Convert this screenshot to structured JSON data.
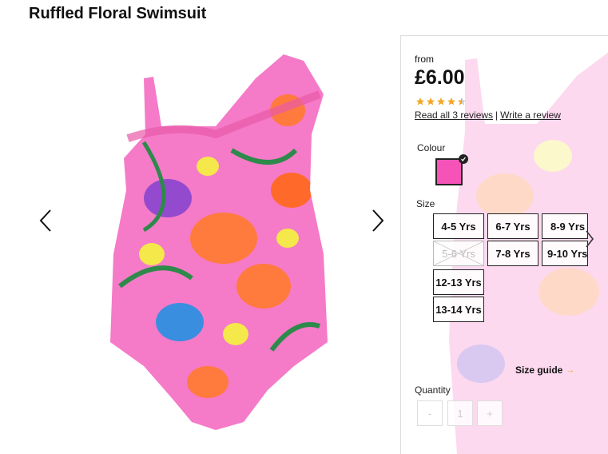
{
  "product": {
    "title": "Ruffled Floral Swimsuit"
  },
  "gallery": {
    "prev_icon": "chevron-left-icon",
    "next_icon": "chevron-right-icon",
    "image_subject": "pink floral one-shoulder ruffled swimsuit"
  },
  "pricing": {
    "from_label": "from",
    "price": "£6.00"
  },
  "rating": {
    "stars": 4.5,
    "max": 5,
    "star_color": "#f5a623",
    "read_reviews": "Read all 3 reviews",
    "separator": "|",
    "write_review": "Write a review"
  },
  "colour": {
    "label": "Colour",
    "selected_hex": "#f553b8"
  },
  "size": {
    "label": "Size",
    "options": [
      {
        "label": "4-5 Yrs",
        "available": true
      },
      {
        "label": "6-7 Yrs",
        "available": true
      },
      {
        "label": "8-9 Yrs",
        "available": true
      },
      {
        "label": "5-6 Yrs",
        "available": false
      },
      {
        "label": "7-8 Yrs",
        "available": true
      },
      {
        "label": "9-10 Yrs",
        "available": true
      },
      {
        "label": "12-13 Yrs",
        "available": true
      },
      {
        "label": "13-14 Yrs",
        "available": true
      }
    ],
    "guide_label": "Size guide",
    "guide_arrow": "→"
  },
  "quantity": {
    "label": "Quantity",
    "minus": "-",
    "value": "1",
    "plus": "+"
  }
}
